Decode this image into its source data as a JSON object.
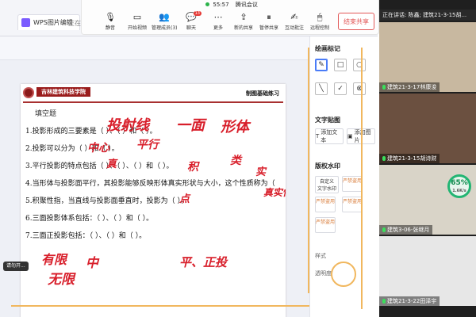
{
  "size_tip": "1401x962px",
  "wps": {
    "tab_title": "WPS图片编辑",
    "tab2": "正在..."
  },
  "meeting": {
    "time": "55:57",
    "app_name": "腾讯会议",
    "toolbar": [
      {
        "label": "静音",
        "icon": "mic-icon"
      },
      {
        "label": "开始视频",
        "icon": "camera-icon"
      },
      {
        "label": "管理成员(3)",
        "icon": "members-icon"
      },
      {
        "label": "聊天",
        "icon": "chat-icon",
        "badge": "13"
      },
      {
        "label": "更多",
        "icon": "more-icon"
      },
      {
        "label": "新的共享",
        "icon": "share-icon"
      },
      {
        "label": "暂停共享",
        "icon": "pause-icon"
      },
      {
        "label": "互动批注",
        "icon": "annotate-icon"
      },
      {
        "label": "远程控制",
        "icon": "remote-icon"
      }
    ],
    "end_share": "结束共享"
  },
  "sec_bar": {
    "zoom_label": "透明度"
  },
  "document": {
    "school_name": "吉林建筑科技学院",
    "section_title": "制图基础练习",
    "heading": "填空题",
    "questions": [
      "1.投影形成的三要素是（              ）、（         ）和（           ）。",
      "2.投影可以分为（           ）和（            ）。",
      "3.平行投影的特点包括（         ）、（         ）、（          ）和（          ）。",
      "4.当形体与投影面平行，其投影能够反映形体真实形状与大小，这个性质称为（",
      "5.积聚性指，当直线与投影面垂直时，投影为（         ）。",
      "6.三面投影体系包括：（                      ）、（                  ）和（          ）。",
      "7.三面正投影包括：（             ）、（              ）和（          ）。"
    ],
    "annotations": [
      "投射线",
      "一面",
      "形体",
      "中心",
      "平行",
      "真",
      "积",
      "类",
      "实",
      "真实性",
      "点",
      "有限",
      "无限",
      "中",
      "平、正投"
    ]
  },
  "panel": {
    "draw_title": "绘画标记",
    "text_title": "文字贴图",
    "add_text": "添加文本",
    "add_image": "添加图片",
    "watermark_title": "版权水印",
    "custom_watermark": "自定义\n文字水印",
    "wm_samples": [
      "严禁盗用",
      "严禁盗用",
      "严禁盗用",
      "严禁盗用"
    ],
    "style_label": "样式",
    "opacity_label": "透明度"
  },
  "status_pill": "请勿开...",
  "video": {
    "speaking": "正在讲话: 陈鑫; 建筑21-3-15胡...",
    "tiles": [
      {
        "name": "建筑21-3-17林康浚",
        "bg": "#c8b8a0"
      },
      {
        "name": "建筑21-3-15胡诗财",
        "bg": "#6b5040"
      },
      {
        "name": "建筑3-06-张继月",
        "bg": "#d9d4c8"
      },
      {
        "name": "建筑21-3-22田泽宇",
        "bg": "#e7e7e7"
      }
    ],
    "percent": "65%",
    "percent_sub": "1.6K/s"
  },
  "colors": {
    "accent": "#4a7cf7",
    "ink": "#d81e2a",
    "brand": "#9a1c1c",
    "share_red": "#e25757"
  }
}
